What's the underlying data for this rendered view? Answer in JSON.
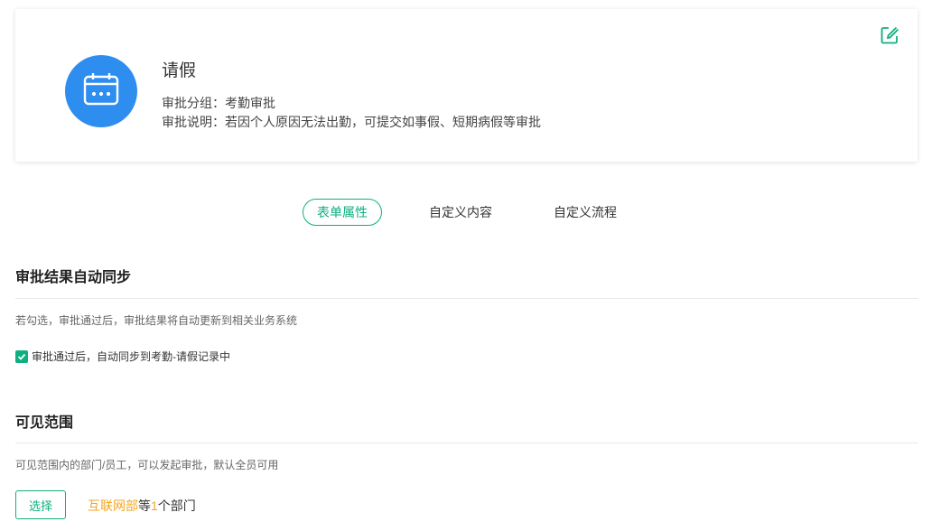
{
  "header": {
    "title": "请假",
    "group_text": "审批分组：考勤审批",
    "desc_text": "审批说明：若因个人原因无法出勤，可提交如事假、短期病假等审批",
    "avatar_icon": "calendar-icon",
    "edit_icon": "edit-icon"
  },
  "tabs": [
    {
      "label": "表单属性",
      "active": true
    },
    {
      "label": "自定义内容",
      "active": false
    },
    {
      "label": "自定义流程",
      "active": false
    }
  ],
  "sync_section": {
    "title": "审批结果自动同步",
    "desc": "若勾选，审批通过后，审批结果将自动更新到相关业务系统",
    "checkbox_label": "审批通过后，自动同步到考勤-请假记录中",
    "checked": true
  },
  "visibility_section": {
    "title": "可见范围",
    "desc": "可见范围内的部门/员工，可以发起审批，默认全员可用",
    "select_label": "选择",
    "dept_name": "互联网部",
    "mid_text": "等",
    "count": "1",
    "suffix": "个部门"
  },
  "colors": {
    "accent": "#0eb080",
    "avatar_bg": "#2e8ef0",
    "highlight": "#f5a623"
  }
}
